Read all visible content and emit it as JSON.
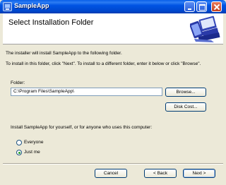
{
  "window": {
    "title": "SampleApp"
  },
  "banner": {
    "title": "Select Installation Folder"
  },
  "body": {
    "intro": "The installer will install SampleApp to the following folder.",
    "instructions": "To install in this folder, click \"Next\". To install to a different folder, enter it below or click \"Browse\".",
    "folder_label": "Folder:",
    "folder_value": "C:\\Program Files\\SampleApp\\",
    "install_for_label": "Install SampleApp for yourself, or for anyone who uses this computer:"
  },
  "buttons": {
    "browse": "Browse...",
    "disk_cost": "Disk Cost...",
    "cancel": "Cancel",
    "back": "< Back",
    "next": "Next >"
  },
  "install_for": {
    "options": [
      "Everyone",
      "Just me"
    ],
    "selected": "Just me"
  }
}
